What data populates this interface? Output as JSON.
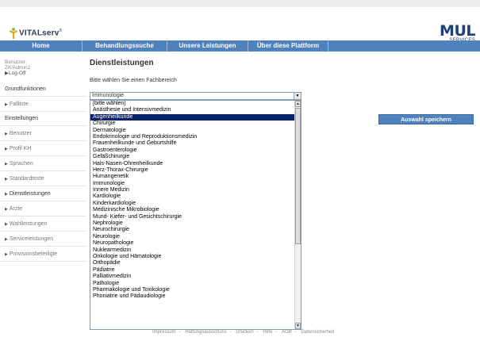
{
  "header": {
    "logo_text": "VITALserv",
    "logo_tm": "®",
    "brand_right_main": "MUL",
    "brand_right_sub": "SERVICES"
  },
  "nav": {
    "items": [
      {
        "label": "Home"
      },
      {
        "label": "Behandlungssuche"
      },
      {
        "label": "Unsere Leistungen"
      },
      {
        "label": "Über diese Plattform"
      }
    ]
  },
  "sidebar": {
    "user_label": "Benutzer:",
    "user_name": "ZK/Admin2",
    "logoff": "Log-Off",
    "head_grund": "Grundfunktionen",
    "item_fallliste": "Fallliste",
    "head_einstellungen": "Einstellungen",
    "items": [
      {
        "label": "Benutzer"
      },
      {
        "label": "Profil KH"
      },
      {
        "label": "Sprachen"
      },
      {
        "label": "Standardtexte"
      },
      {
        "label": "Dienstleistungen"
      },
      {
        "label": "Ärzte"
      },
      {
        "label": "Wahlleistungen"
      },
      {
        "label": "Serviceleistungen"
      },
      {
        "label": "Provisionsbeteiligte"
      }
    ]
  },
  "main": {
    "title": "Dienstleistungen",
    "subtitle": "Bitte wählen Sie einen Fachbereich",
    "select_value": "Immunologie",
    "options": [
      "[bitte wählen]",
      "Anästhesie und Intensivmedizin",
      "Augenheilkunde",
      "Chirurgie",
      "Dermatologie",
      "Endokrinologie und Reproduktionsmedizin",
      "Frauenheilkunde und Geburtshilfe",
      "Gastroenterologie",
      "Gefäßchirurgie",
      "Hals-Nasen-Ohrenheilkunde",
      "Herz-Thorax-Chirurgie",
      "Humangenetik",
      "Immunologie",
      "Innere Medizin",
      "Kardiologie",
      "Kinderkardiologie",
      "Medizinische Mikrobiologie",
      "Mund- Kiefer- und Gesichtschirurgie",
      "Nephrologie",
      "Neurochirurgie",
      "Neurologie",
      "Neuropathologie",
      "Nuklearmedizin",
      "Onkologie und Hämatologie",
      "Orthopädie",
      "Pädiatrie",
      "Palliativmedizin",
      "Pathologie",
      "Pharmakologie und Toxikologie",
      "Phoniatrie und Pädaudiologie"
    ],
    "highlighted_option": "Augenheilkunde",
    "save_button": "Auswahl speichern"
  },
  "footer": {
    "items": [
      "Impressum",
      "Haftungsausschuss",
      "Drucken",
      "Hilfe",
      "AGB",
      "Datensicherheit"
    ],
    "separator": "-"
  },
  "colors": {
    "nav_bg": "#4f81bd",
    "selected_option_bg": "#0a246a",
    "brand_blue": "#1d3f7a",
    "logo_green": "#8cbf3f",
    "logo_orange": "#f0a400"
  }
}
